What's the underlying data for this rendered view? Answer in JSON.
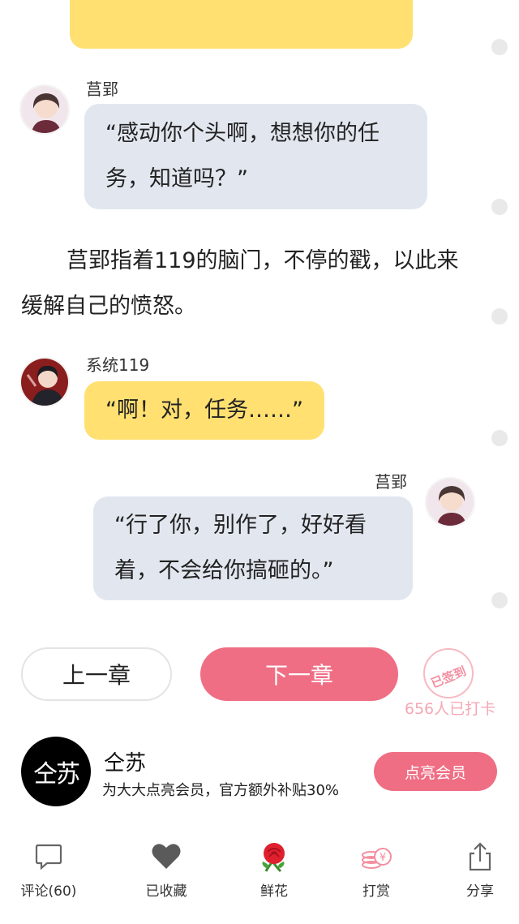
{
  "chat": {
    "msg1": {
      "name": "莒郢",
      "text": "“感动你个头啊，想想你的任务，知道吗？”"
    },
    "narration": "莒郢指着119的脑门，不停的戳，以此来缓解自己的愤怒。",
    "msg2": {
      "name": "系统119",
      "text": "“啊！对，任务……”"
    },
    "msg3": {
      "name": "莒郢",
      "text": "“行了你，别作了，好好看着，不会给你搞砸的。”"
    }
  },
  "chapter_nav": {
    "prev_label": "上一章",
    "next_label": "下一章",
    "stamp_label": "已签到",
    "checkin_count": "656人已打卡"
  },
  "author": {
    "avatar_text": "仝苏",
    "name": "仝苏",
    "description": "为大大点亮会员，官方额外补贴30%",
    "vip_button": "点亮会员"
  },
  "bottom_bar": {
    "comment": "评论(60)",
    "favorite": "已收藏",
    "flower": "鲜花",
    "reward": "打赏",
    "share": "分享"
  },
  "colors": {
    "accent_pink": "#ef6e84",
    "bubble_gray": "#e2e7ef",
    "bubble_yellow": "#ffe071"
  }
}
